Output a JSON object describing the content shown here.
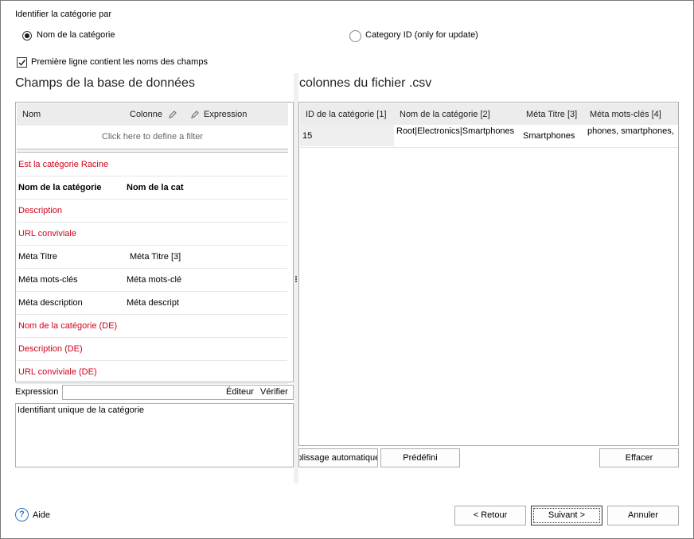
{
  "identify": {
    "label": "Identifier la catégorie par",
    "option_name": "Nom de la catégorie",
    "option_id": "Category ID (only for update)",
    "first_line_label": "Première ligne contient les noms des champs"
  },
  "left": {
    "heading": "Champs de la base de données",
    "headers": {
      "nom": "Nom",
      "colonne": "Colonne",
      "expression": "Expression"
    },
    "filter_text": "Click here to define a filter",
    "rows": [
      {
        "nom": "Est la catégorie Racine",
        "colonne": "",
        "style": "red"
      },
      {
        "nom": "Nom de la catégorie",
        "colonne": "Nom de la cat",
        "style": "bold"
      },
      {
        "nom": "Description",
        "colonne": "",
        "style": "red"
      },
      {
        "nom": "URL conviviale",
        "colonne": "",
        "style": "red"
      },
      {
        "nom": "Méta Titre",
        "colonne": "Méta Titre [3]",
        "style": "normal"
      },
      {
        "nom": "Méta mots-clés",
        "colonne": "Méta mots-clé",
        "style": "normal"
      },
      {
        "nom": "Méta description",
        "colonne": "Méta descript",
        "style": "normal"
      },
      {
        "nom": "Nom de la catégorie (DE)",
        "colonne": "",
        "style": "red"
      },
      {
        "nom": "Description (DE)",
        "colonne": "",
        "style": "red"
      },
      {
        "nom": "URL conviviale (DE)",
        "colonne": "",
        "style": "red"
      }
    ],
    "expression_label": "Expression",
    "editor_label": "Éditeur",
    "verify_label": "Vérifier",
    "description_text": "Identifiant unique de la catégorie"
  },
  "right": {
    "heading": "colonnes du fichier .csv",
    "headers": [
      "ID de la catégorie [1]",
      "Nom de la catégorie [2]",
      "Méta Titre [3]",
      "Méta mots-clés [4]"
    ],
    "row": [
      "15",
      "Root|Electronics|Smartphones",
      "Smartphones",
      "phones, smartphones,"
    ],
    "btn_auto": "Remplissage automatique",
    "btn_predefined": "Prédéfini",
    "btn_clear": "Effacer"
  },
  "footer": {
    "help": "Aide",
    "back": "< Retour",
    "next": "Suivant >",
    "cancel": "Annuler"
  },
  "colors": {
    "required": "#d0021b",
    "accent": "#2f6fc6"
  },
  "icons": {
    "pencil": "pencil-icon",
    "help": "help-icon",
    "check": "checkmark-icon"
  }
}
